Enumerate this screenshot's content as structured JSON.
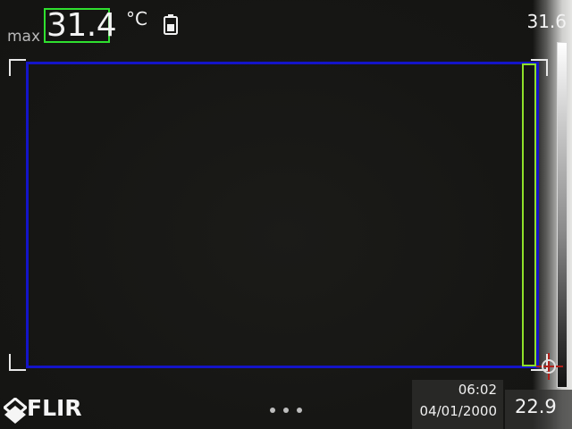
{
  "measurement": {
    "label": "max",
    "value": "31.4",
    "unit": "°C"
  },
  "scale": {
    "max": "31.6",
    "min": "22.9"
  },
  "status": {
    "battery_icon": "battery-icon"
  },
  "datetime": {
    "time": "06:02",
    "date": "04/01/2000"
  },
  "brand": {
    "logo_text": "FLIR"
  },
  "colors": {
    "max_box": "#2fe02f",
    "measure_box": "#1414c8",
    "hot_spot_marker": "#8ee02a",
    "crosshair": "#b0201a"
  },
  "pager": {
    "dots": 3
  }
}
